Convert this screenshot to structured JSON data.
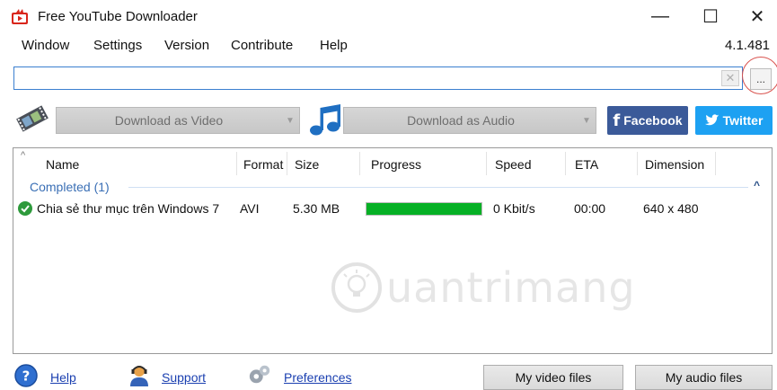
{
  "window": {
    "title": "Free YouTube Downloader",
    "controls": {
      "minimize": "—",
      "maximize": "☐",
      "close": "✕"
    }
  },
  "menu": {
    "items": [
      "Window",
      "Settings",
      "Version",
      "Contribute",
      "Help"
    ],
    "version": "4.1.481"
  },
  "url_bar": {
    "value": "",
    "placeholder": "",
    "clear_icon": "✕",
    "browse_label": "..."
  },
  "toolbar": {
    "download_video_label": "Download as Video",
    "download_audio_label": "Download as Audio",
    "facebook_label": "Facebook",
    "twitter_label": "Twitter"
  },
  "list": {
    "columns": [
      "Name",
      "Format",
      "Size",
      "Progress",
      "Speed",
      "ETA",
      "Dimension"
    ],
    "group_label": "Completed (1)",
    "rows": [
      {
        "name": "Chia sẻ thư mục trên Windows 7",
        "format": "AVI",
        "size": "5.30 MB",
        "progress": 1.0,
        "speed": "0 Kbit/s",
        "eta": "00:00",
        "dimension": "640 x 480"
      }
    ]
  },
  "watermark": {
    "text": "uantrimang"
  },
  "footer": {
    "help_label": "Help",
    "support_label": "Support",
    "preferences_label": "Preferences",
    "my_video_files_label": "My video files",
    "my_audio_files_label": "My audio files"
  },
  "colors": {
    "facebook": "#3b5a99",
    "twitter": "#1da1f2",
    "progress": "#06b025",
    "group_text": "#3a6fb5",
    "link": "#1a3fb0"
  }
}
